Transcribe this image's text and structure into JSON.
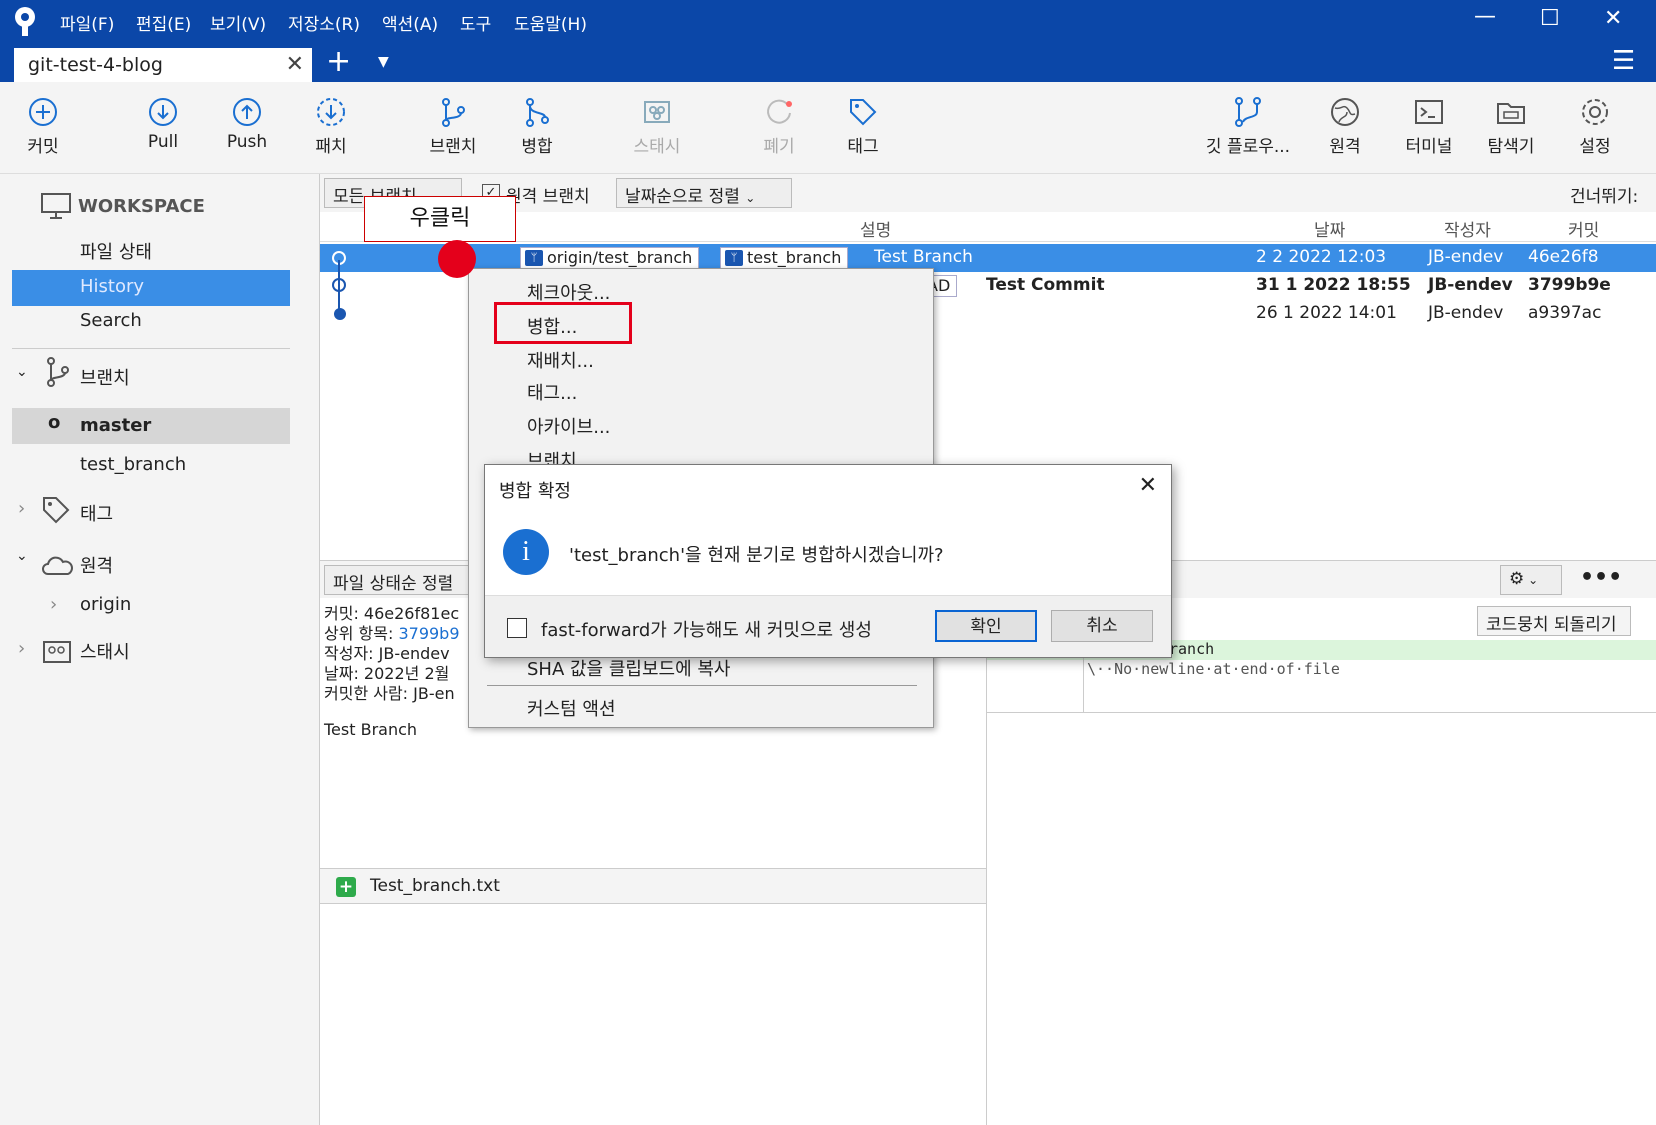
{
  "menu": [
    "파일(F)",
    "편집(E)",
    "보기(V)",
    "저장소(R)",
    "액션(A)",
    "도구",
    "도움말(H)"
  ],
  "repo_tab": "git-test-4-blog",
  "toolbar": {
    "commit": "커밋",
    "pull": "Pull",
    "push": "Push",
    "patch": "패치",
    "branch": "브랜치",
    "merge": "병합",
    "stash": "스태시",
    "discard": "폐기",
    "tag": "태그",
    "gitflow": "깃 플로우...",
    "remote": "원격",
    "terminal": "터미널",
    "explorer": "탐색기",
    "settings": "설정"
  },
  "sidebar": {
    "workspace": "WORKSPACE",
    "file_status": "파일 상태",
    "history": "History",
    "search": "Search",
    "branches": "브랜치",
    "branch_master": "master",
    "branch_test": "test_branch",
    "tags": "태그",
    "remotes": "원격",
    "origin": "origin",
    "stashes": "스태시"
  },
  "filter": {
    "all_branches": "모든 브랜치",
    "remote_branches": "원격 브랜치",
    "sort": "날짜순으로 정렬",
    "skip": "건너뛰기:"
  },
  "columns": {
    "description": "설명",
    "date": "날짜",
    "author": "작성자",
    "commit": "커밋"
  },
  "commits": [
    {
      "refs": [
        "origin/test_branch",
        "test_branch"
      ],
      "message": "Test Branch",
      "date": "2 2 2022 12:03",
      "author": "JB-endev",
      "hash": "46e26f8"
    },
    {
      "refs": [
        "AD"
      ],
      "message": "Test Commit",
      "date": "31 1 2022 18:55",
      "author": "JB-endev",
      "hash": "3799b9e"
    },
    {
      "message": "",
      "date": "26 1 2022 14:01",
      "author": "JB-endev",
      "hash": "a9397ac"
    }
  ],
  "annotation": "우클릭",
  "context_menu": [
    "체크아웃...",
    "병합...",
    "재배치...",
    "태그...",
    "아카이브...",
    "브랜치...",
    "SHA 값을 클립보드에 복사",
    "커스텀 액션"
  ],
  "dialog": {
    "title": "병합 확정",
    "message": "'test_branch'을 현재 분기로 병합하시겠습니까?",
    "checkbox": "fast-forward가 가능해도 새 커밋으로 생성",
    "ok": "확인",
    "cancel": "취소"
  },
  "lower_left": {
    "sort": "파일 상태순 정렬",
    "details": [
      "커밋: 46e26f81ec",
      "상위 항목: 3799b9",
      "작성자: JB-endev",
      "날짜: 2022년 2월",
      "커밋한 사람: JB-en"
    ],
    "parent_link": "3799b9",
    "message": "Test Branch",
    "file": "Test_branch.txt"
  },
  "diff": {
    "revert": "코드뭉치 되돌리기",
    "line1": "ranch",
    "line2": "\\··No·newline·at·end·of·file"
  },
  "colors": {
    "accent": "#0b47a8",
    "selection": "#3a8ee6",
    "annotation": "#e4001b"
  }
}
